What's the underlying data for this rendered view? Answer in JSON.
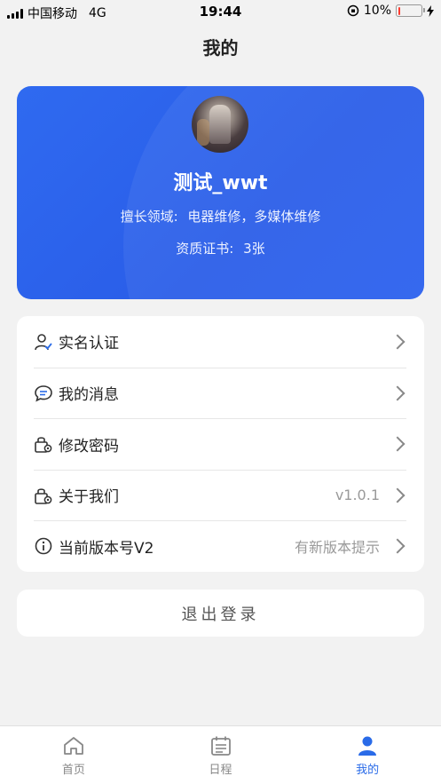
{
  "status_bar": {
    "carrier": "中国移动",
    "network": "4G",
    "time": "19:44",
    "battery_percent": "10%",
    "battery_level": 0.1
  },
  "header": {
    "title": "我的"
  },
  "profile": {
    "name": "测试_wwt",
    "specialty_label": "擅长领域:",
    "specialty_value": "电器维修，多媒体维修",
    "certificates_label": "资质证书:",
    "certificates_value": "3张"
  },
  "menu": [
    {
      "label": "实名认证",
      "value": "",
      "icon": "user-verify-icon"
    },
    {
      "label": "我的消息",
      "value": "",
      "icon": "message-icon"
    },
    {
      "label": "修改密码",
      "value": "",
      "icon": "lock-gear-icon"
    },
    {
      "label": "关于我们",
      "value": "v1.0.1",
      "icon": "lock-gear-icon"
    },
    {
      "label": "当前版本号V2",
      "value": "有新版本提示",
      "icon": "info-icon"
    }
  ],
  "logout_label": "退出登录",
  "tabs": [
    {
      "label": "首页",
      "icon": "home-icon",
      "active": false
    },
    {
      "label": "日程",
      "icon": "calendar-icon",
      "active": false
    },
    {
      "label": "我的",
      "icon": "person-icon",
      "active": true
    }
  ],
  "colors": {
    "accent": "#2a6be8",
    "card_bg": "#2e65ee"
  }
}
